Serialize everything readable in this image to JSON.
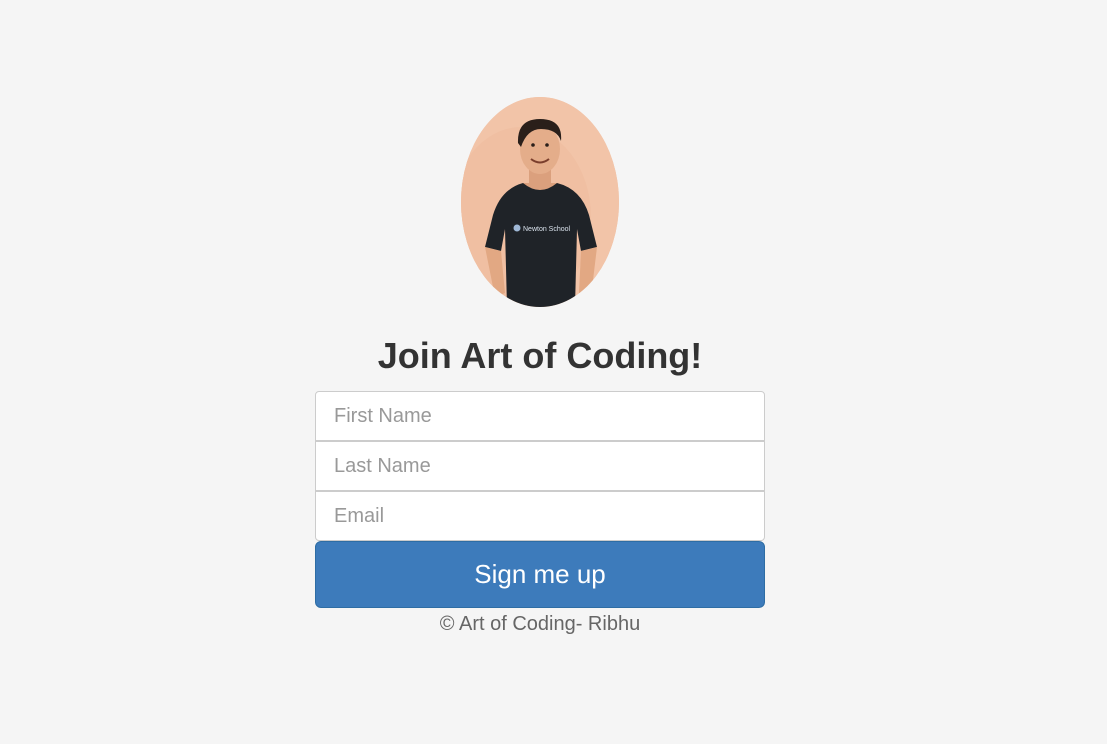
{
  "profile": {
    "avatar_alt": "Profile photo",
    "shirt_text": "Newton School"
  },
  "signup": {
    "heading": "Join Art of Coding!",
    "first_name_placeholder": "First Name",
    "last_name_placeholder": "Last Name",
    "email_placeholder": "Email",
    "submit_label": "Sign me up"
  },
  "footer": {
    "text": "© Art of Coding- Ribhu"
  },
  "colors": {
    "background": "#f5f5f5",
    "primary_button": "#3d7bbb",
    "heading_text": "#333333"
  }
}
